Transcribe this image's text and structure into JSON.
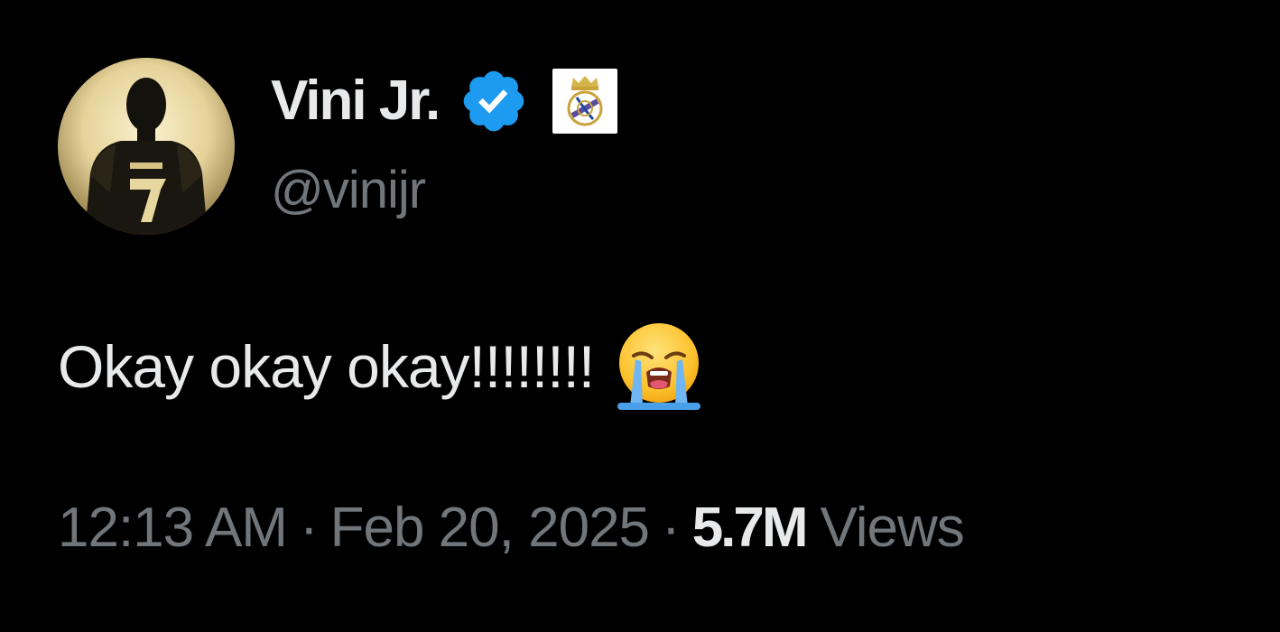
{
  "tweet": {
    "author": {
      "display_name": "Vini Jr.",
      "handle": "@vinijr",
      "verified_icon": "verified-badge-icon",
      "verified_color": "#1d9bf0",
      "affiliate_icon": "real-madrid-crest-icon",
      "avatar_icon": "player-silhouette-number-7"
    },
    "text": "Okay okay okay!!!!!!!!",
    "emoji": "loudly-crying-face-emoji",
    "meta": {
      "time": "12:13 AM",
      "separator": "·",
      "date": "Feb 20, 2025",
      "views_count": "5.7M",
      "views_label": "Views"
    }
  },
  "colors": {
    "background": "#000000",
    "primary_text": "#e7e9ea",
    "secondary_text": "#71767b",
    "accent_blue": "#1d9bf0"
  }
}
